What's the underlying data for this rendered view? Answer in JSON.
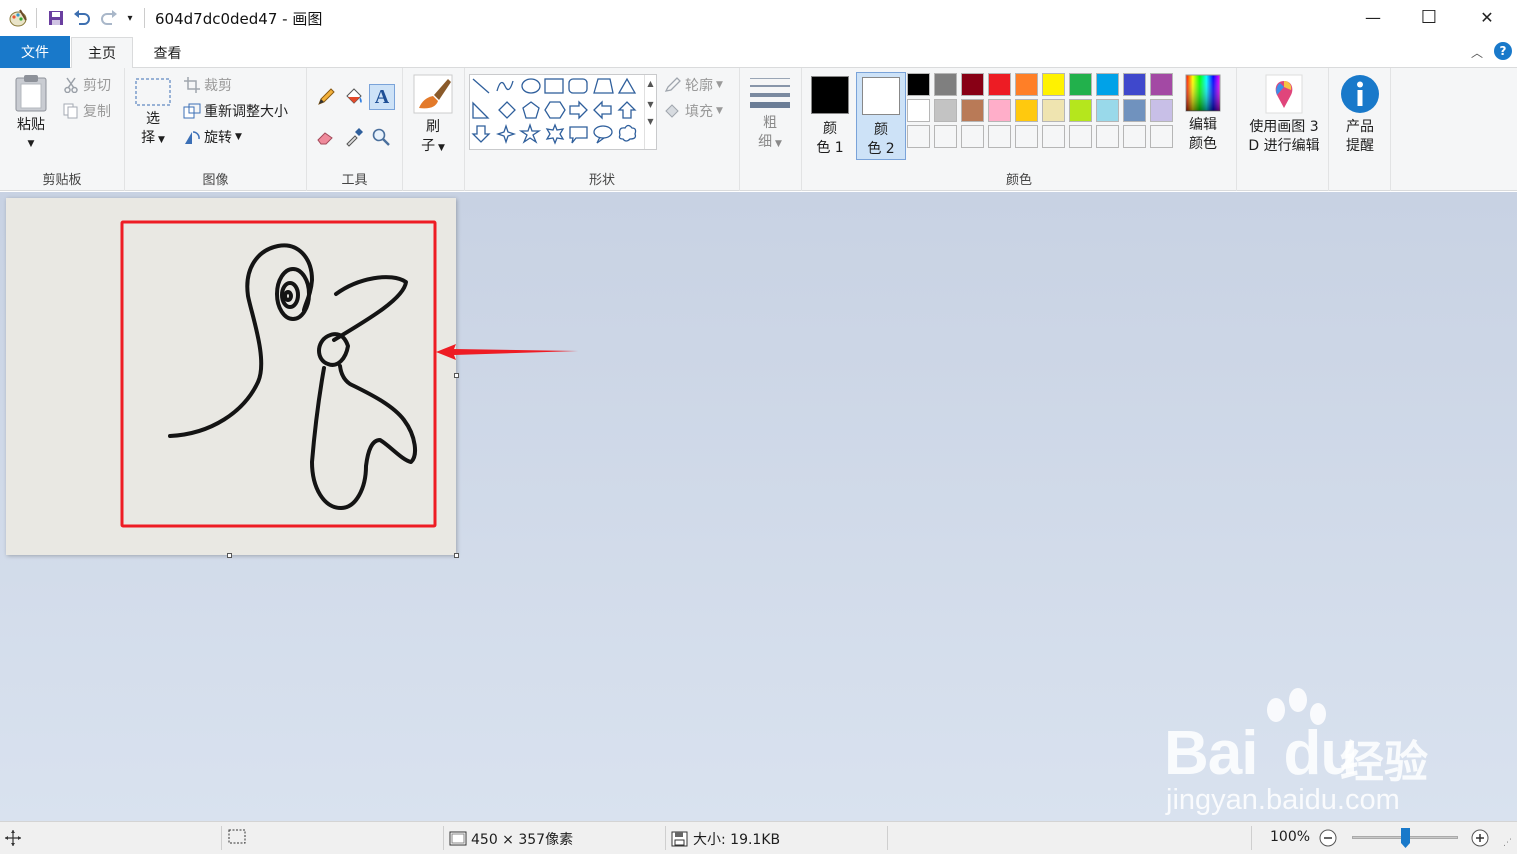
{
  "window": {
    "title": "604d7dc0ded47 - 画图",
    "minimize_glyph": "—",
    "maximize_glyph": "☐",
    "close_glyph": "✕"
  },
  "tabs": {
    "file": "文件",
    "home": "主页",
    "view": "查看"
  },
  "ribbon": {
    "clipboard": {
      "label": "剪贴板",
      "paste": "粘贴",
      "cut": "剪切",
      "copy": "复制"
    },
    "image": {
      "label": "图像",
      "select_line1": "选",
      "select_line2": "择",
      "crop": "裁剪",
      "resize": "重新调整大小",
      "rotate": "旋转"
    },
    "tools": {
      "label": "工具"
    },
    "brushes": {
      "line1": "刷",
      "line2": "子"
    },
    "shapes": {
      "label": "形状",
      "outline": "轮廓",
      "fill": "填充"
    },
    "size": {
      "line1": "粗",
      "line2": "细"
    },
    "colors": {
      "label": "颜色",
      "color1_line1": "颜",
      "color1_line2": "色 1",
      "color2_line1": "颜",
      "color2_line2": "色 2",
      "color1_value": "#000000",
      "color2_value": "#ffffff",
      "edit_line1": "编辑",
      "edit_line2": "颜色",
      "palette_row1": [
        "#000000",
        "#7f7f7f",
        "#880015",
        "#ed1c24",
        "#ff7f27",
        "#fff200",
        "#22b14c",
        "#00a2e8",
        "#3f48cc",
        "#a349a4"
      ],
      "palette_row2": [
        "#ffffff",
        "#c3c3c3",
        "#b97a57",
        "#ffaec9",
        "#ffc90e",
        "#efe4b0",
        "#b5e61d",
        "#99d9ea",
        "#7092be",
        "#c8bfe7"
      ]
    },
    "paint3d": {
      "line1": "使用画图 3",
      "line2": "D 进行编辑"
    },
    "alert": {
      "line1": "产品",
      "line2": "提醒"
    }
  },
  "statusbar": {
    "image_size": "450 × 357像素",
    "file_size": "大小: 19.1KB",
    "zoom": "100%",
    "zoom_fraction": 0.5
  },
  "watermark": {
    "brand": "Bai",
    "brand2": "du",
    "cn": "经验",
    "url": "jingyan.baidu.com"
  },
  "colors": {
    "accent": "#1979ca",
    "annotation_red": "#ee1c24"
  }
}
